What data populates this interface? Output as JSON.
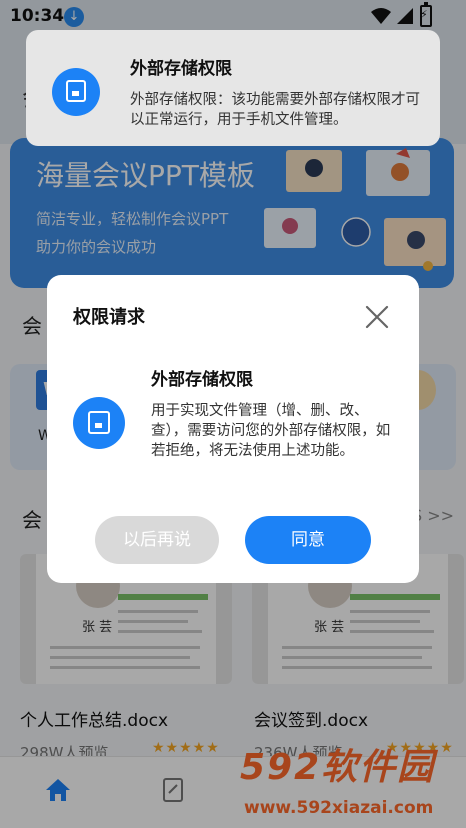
{
  "status_bar": {
    "time": "10:34"
  },
  "notification": {
    "title": "外部存储权限",
    "body": "外部存储权限：该功能需要外部存储权限才可以正常运行，用于手机文件管理。",
    "icon": "folder-icon"
  },
  "background": {
    "header_char": "会",
    "banner": {
      "title": "海量会议PPT模板",
      "line1": "简洁专业，轻松制作会议PPT",
      "line2": "助力你的会议成功"
    },
    "section1_char": "会",
    "card1_icon_letter": "W",
    "card1_label": "W",
    "section2_char": "会",
    "more": "S >>",
    "templates": [
      {
        "name": "个人工作总结.docx",
        "views": "298W人预览",
        "stars": "★★★★★",
        "person": "张 芸"
      },
      {
        "name": "会议签到.docx",
        "views": "236W人预览",
        "stars": "★★★★★",
        "person": "张 芸"
      }
    ]
  },
  "watermark": {
    "brand": "592软件园",
    "url": "www.592xiazai.com"
  },
  "dialog": {
    "header": "权限请求",
    "perm_title": "外部存储权限",
    "perm_desc": "用于实现文件管理（增、删、改、查），需要访问您的外部存储权限，如若拒绝，将无法使用上述功能。",
    "later_label": "以后再说",
    "agree_label": "同意"
  },
  "colors": {
    "accent": "#1c82f6",
    "banner": "#3f8ee6",
    "watermark": "#ff6a2b"
  }
}
